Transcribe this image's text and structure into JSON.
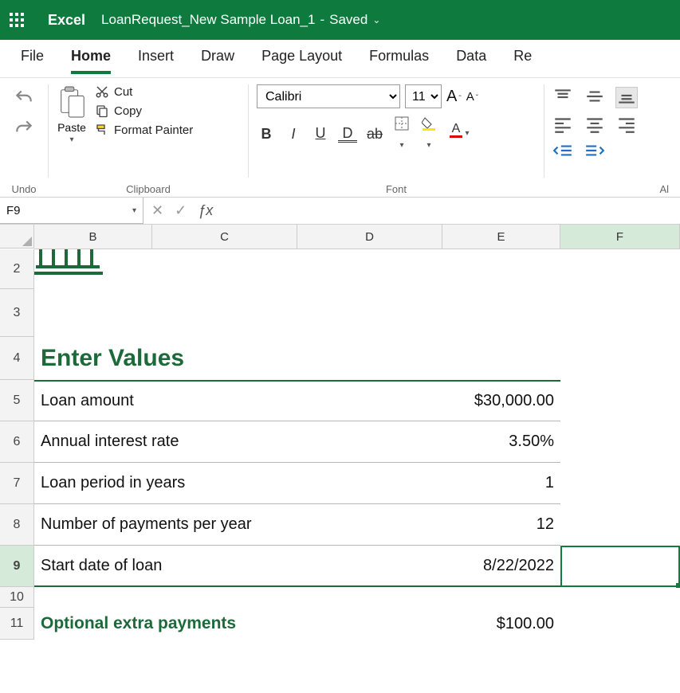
{
  "titlebar": {
    "app": "Excel",
    "doc": "LoanRequest_New Sample Loan_1",
    "status": "Saved"
  },
  "tabs": [
    "File",
    "Home",
    "Insert",
    "Draw",
    "Page Layout",
    "Formulas",
    "Data",
    "Re"
  ],
  "active_tab": "Home",
  "ribbon": {
    "undo_group": "Undo",
    "clipboard_group": "Clipboard",
    "paste": "Paste",
    "cut": "Cut",
    "copy": "Copy",
    "format_painter": "Format Painter",
    "font_group": "Font",
    "font_name": "Calibri",
    "font_size": "11",
    "align_group": "Al"
  },
  "namebox": "F9",
  "formula": "",
  "columns": [
    "B",
    "C",
    "D",
    "E",
    "F"
  ],
  "selected_column": "F",
  "rows": [
    "2",
    "3",
    "4",
    "5",
    "6",
    "7",
    "8",
    "9",
    "10",
    "11"
  ],
  "selected_row": "9",
  "sheet": {
    "section_title": "Enter Values",
    "cut_heading_visible": "─────────────────",
    "labels": {
      "loan_amount": "Loan amount",
      "annual_rate": "Annual interest rate",
      "period_years": "Loan period in years",
      "payments_per_year": "Number of payments per year",
      "start_date": "Start date of loan",
      "optional_extra": "Optional extra payments"
    },
    "values": {
      "loan_amount": "$30,000.00",
      "annual_rate": "3.50%",
      "period_years": "1",
      "payments_per_year": "12",
      "start_date": "8/22/2022",
      "optional_extra": "$100.00"
    }
  }
}
